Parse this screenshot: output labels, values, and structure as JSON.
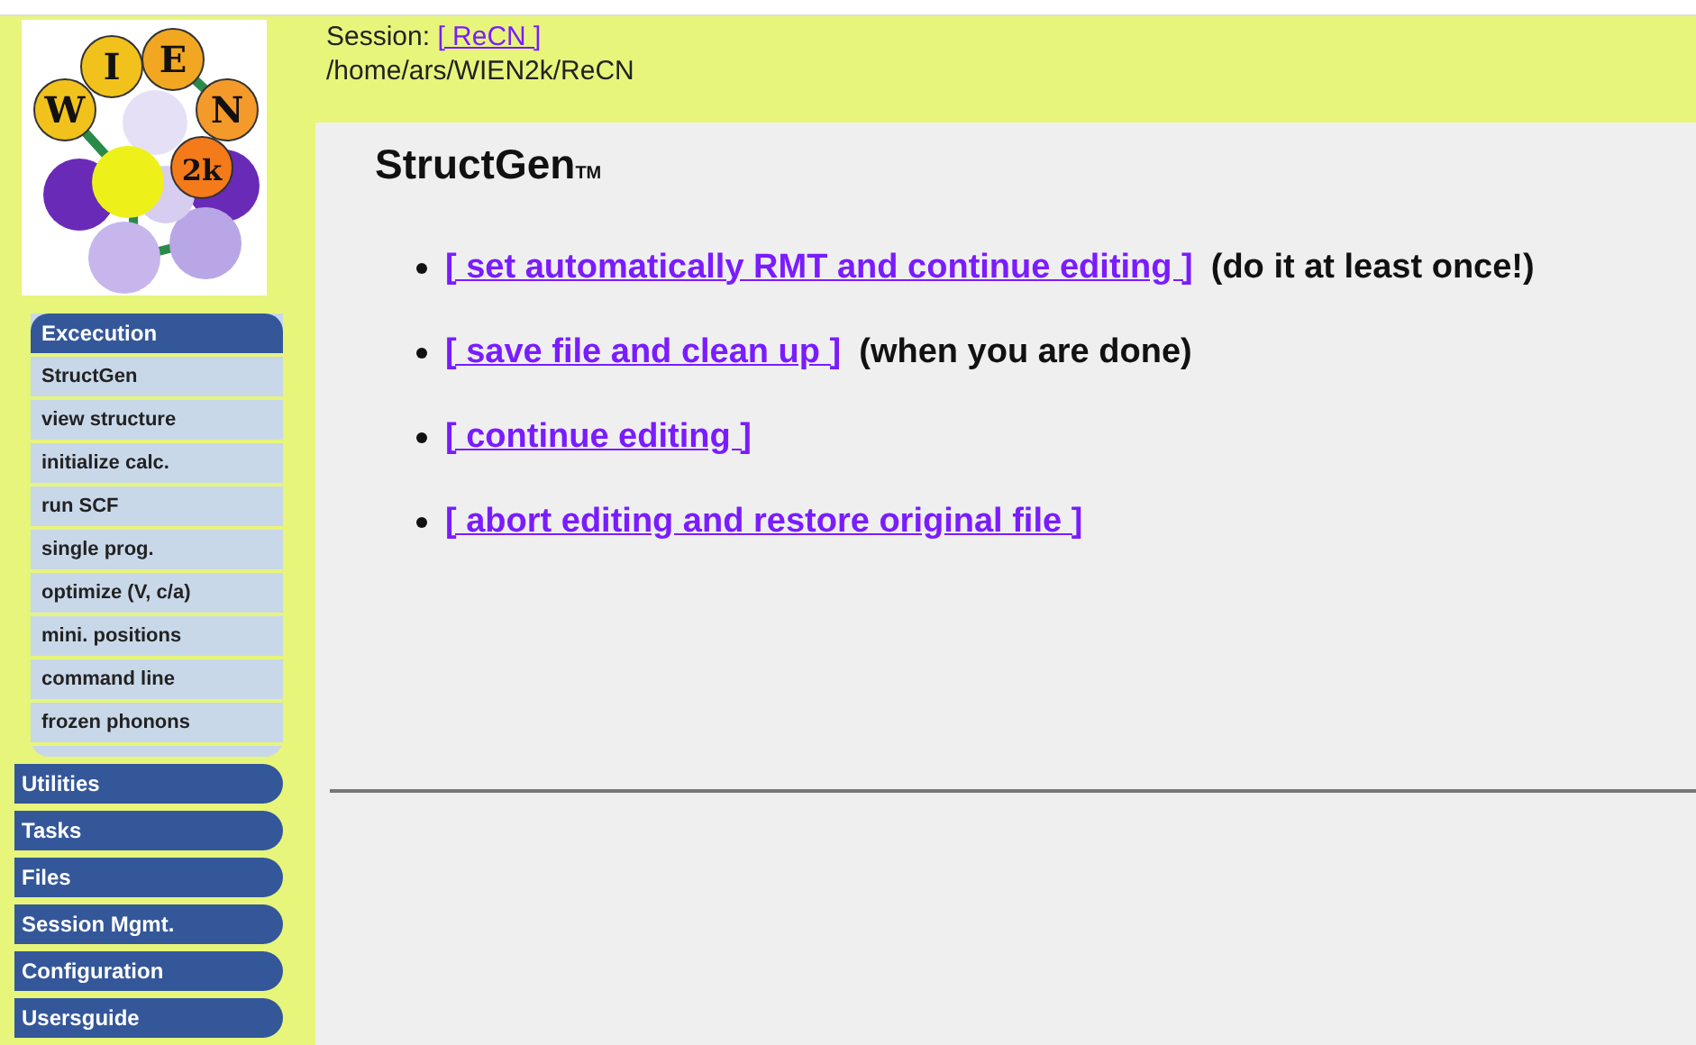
{
  "logo": {
    "letters": [
      "W",
      "I",
      "E",
      "N",
      "2k"
    ]
  },
  "session": {
    "label": "Session:",
    "name": "[ ReCN ]",
    "path": "/home/ars/WIEN2k/ReCN"
  },
  "menu": [
    {
      "label": "Excecution",
      "expanded": true,
      "children": [
        {
          "label": "StructGen"
        },
        {
          "label": "view structure"
        },
        {
          "label": "initialize calc."
        },
        {
          "label": "run SCF"
        },
        {
          "label": "single prog."
        },
        {
          "label": "optimize (V, c/a)"
        },
        {
          "label": "mini. positions"
        },
        {
          "label": "command line"
        },
        {
          "label": "frozen phonons"
        }
      ]
    },
    {
      "label": "Utilities",
      "expanded": false
    },
    {
      "label": "Tasks",
      "expanded": false
    },
    {
      "label": "Files",
      "expanded": false
    },
    {
      "label": "Session Mgmt.",
      "expanded": false
    },
    {
      "label": "Configuration",
      "expanded": false
    },
    {
      "label": "Usersguide",
      "expanded": false
    }
  ],
  "title": {
    "text": "StructGen",
    "mark": "TM"
  },
  "actions": [
    {
      "link": "[ set automatically RMT and continue editing ]",
      "note": "(do it at least once!)"
    },
    {
      "link": "[ save file and clean up ]",
      "note": "(when you are done)"
    },
    {
      "link": "[ continue editing ]"
    },
    {
      "link": "[ abort editing and restore original file ]"
    }
  ]
}
